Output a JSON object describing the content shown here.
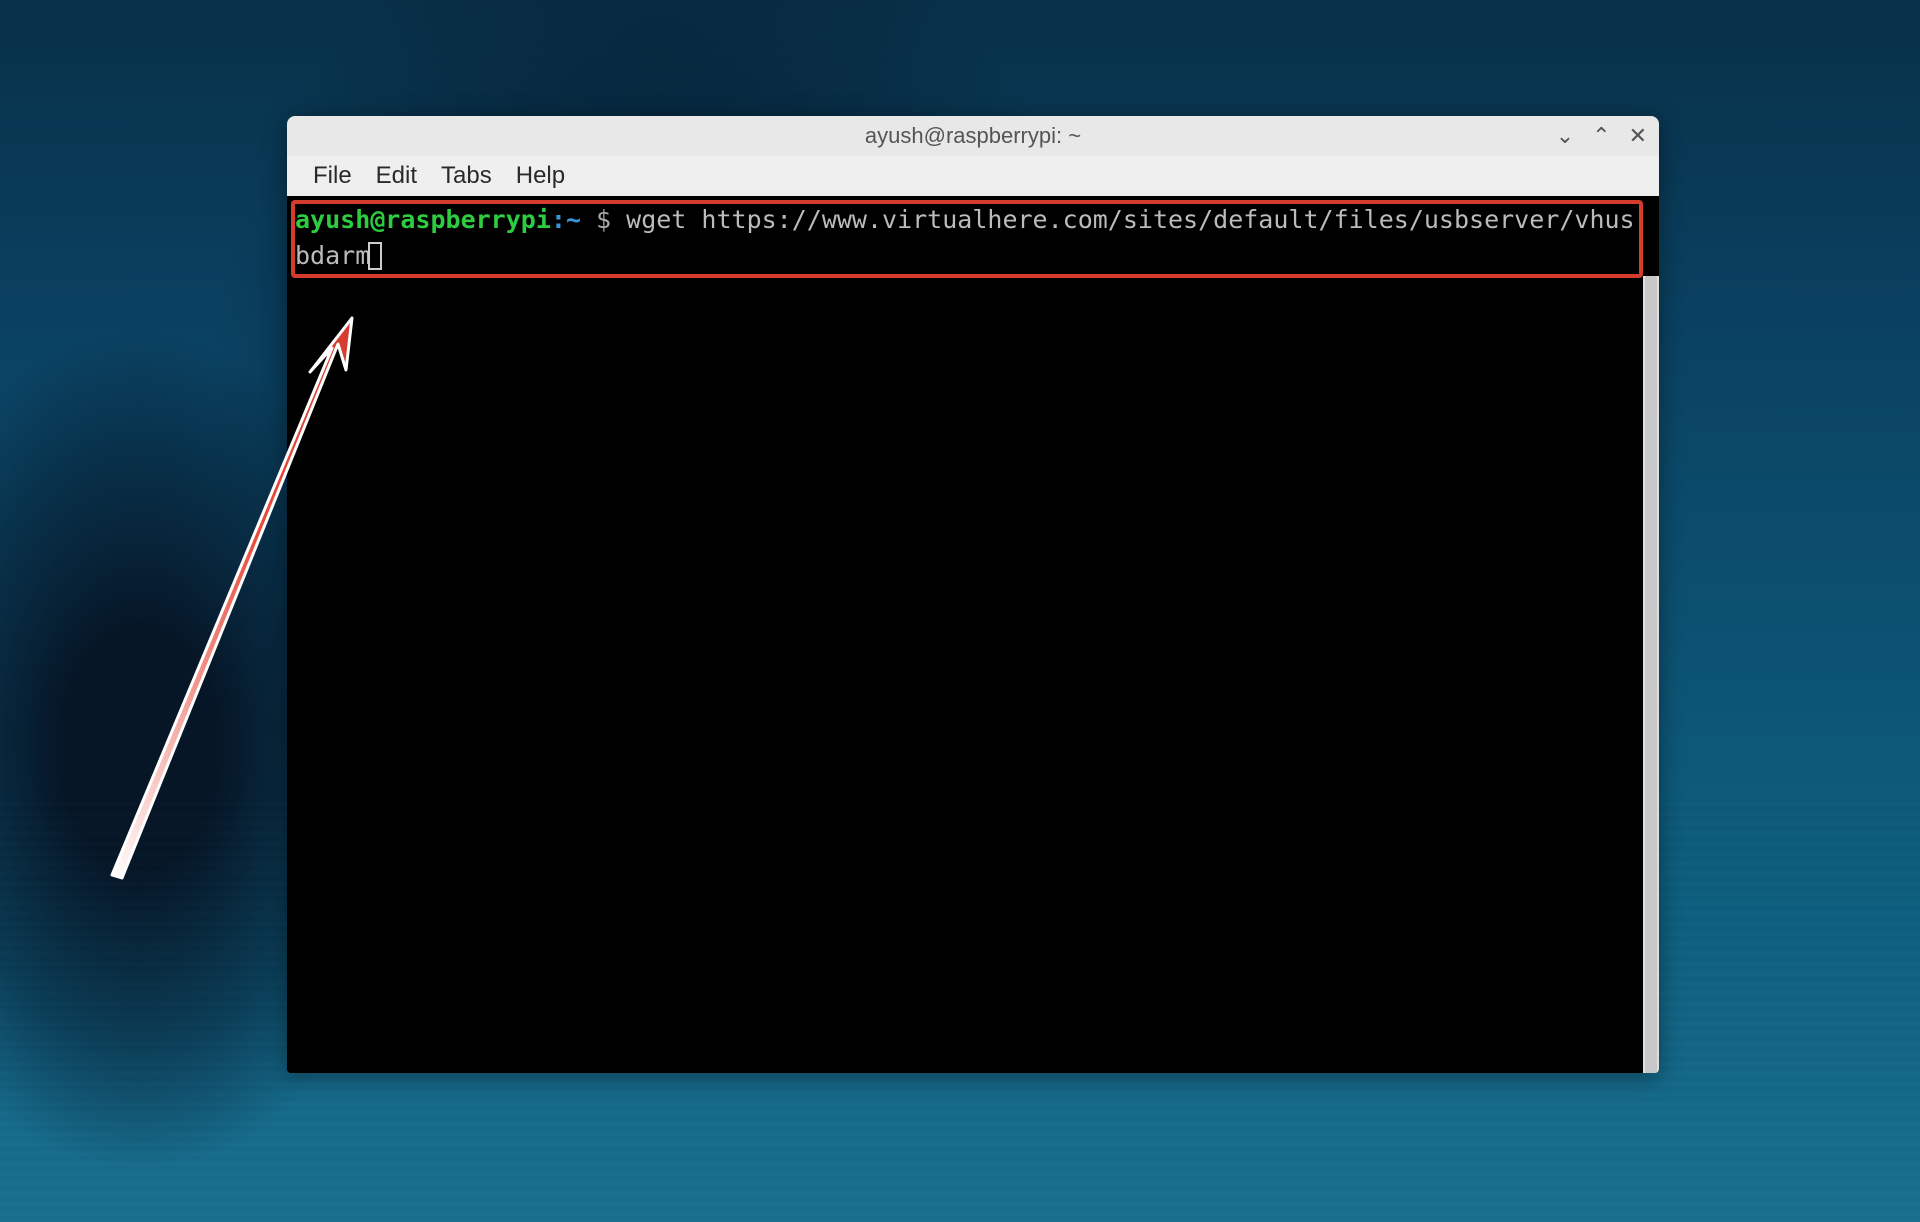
{
  "window": {
    "title": "ayush@raspberrypi: ~"
  },
  "menubar": {
    "items": [
      "File",
      "Edit",
      "Tabs",
      "Help"
    ]
  },
  "terminal": {
    "prompt_user_host": "ayush@raspberrypi",
    "prompt_colon": ":",
    "prompt_path": "~",
    "prompt_symbol": " $ ",
    "command": "wget https://www.virtualhere.com/sites/default/files/usbserver/vhusbdarm"
  },
  "window_controls": {
    "minimize": "⌄",
    "maximize": "⌃",
    "close": "✕"
  }
}
